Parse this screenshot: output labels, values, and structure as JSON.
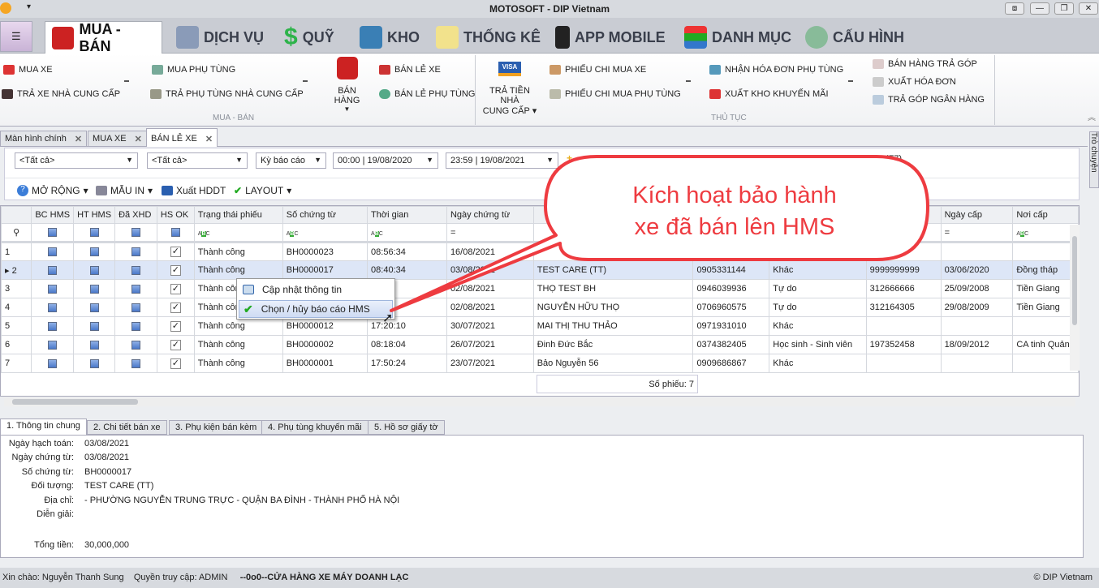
{
  "window": {
    "title": "MOTOSOFT - DIP Vietnam",
    "controls": [
      "⧈",
      "—",
      "❐",
      "✕"
    ]
  },
  "main_tabs": [
    "MUA - BÁN",
    "DỊCH VỤ",
    "QUỸ",
    "KHO",
    "THỐNG KÊ",
    "APP MOBILE",
    "DANH MỤC",
    "CẤU HÌNH"
  ],
  "ribbon": {
    "group1": {
      "label": "MUA - BÁN",
      "mua_xe": "MUA XE",
      "tra_xe": "TRẢ XE NHÀ CUNG CẤP",
      "mua_pt": "MUA PHỤ TÙNG",
      "tra_pt": "TRẢ PHỤ TÙNG NHÀ CUNG CẤP",
      "ban_hang": "BÁN HÀNG",
      "ban_le_xe": "BÁN LẺ XE",
      "ban_le_pt": "BÁN LẺ PHỤ TÙNG"
    },
    "group2": {
      "label": "THỦ TỤC",
      "tra_tien": "TRẢ TIỀN NHÀ",
      "tra_tien2": "CUNG CẤP",
      "pc_mua_xe": "PHIẾU CHI MUA XE",
      "pc_mua_pt": "PHIẾU CHI MUA PHỤ TÙNG",
      "nhan_hd": "NHẬN HÓA ĐƠN PHỤ TÙNG",
      "xuat_km": "XUẤT KHO KHUYẾN MÃI",
      "tra_gop": "BÁN HÀNG TRẢ GÓP",
      "xuat_hd": "XUẤT HÓA ĐƠN",
      "tg_ngan_hang": "TRẢ GÓP NGÂN HÀNG"
    }
  },
  "doc_tabs": [
    "Màn hình chính",
    "MUA XE",
    "BÁN LẺ XE"
  ],
  "side_tab": "Trò chuyện",
  "filters": {
    "f1": "<Tất cả>",
    "f2": "<Tất cả>",
    "period": "Kỳ báo cáo",
    "from": "00:00 | 19/08/2020",
    "to": "23:59 | 19/08/2021",
    "f7": "(F7)"
  },
  "toolbar": {
    "mo_rong": "MỞ RỘNG",
    "mau_in": "MẪU IN",
    "xuat_hddt": "Xuất HDDT",
    "layout": "LAYOUT"
  },
  "grid": {
    "columns": [
      "",
      "BC HMS",
      "HT HMS",
      "Đã XHD",
      "HS OK",
      "Trạng thái phiếu",
      "Số chứng từ",
      "Thời gian",
      "Ngày chứng từ",
      "",
      "",
      "",
      "",
      "Ngày cấp",
      "Nơi cấp"
    ],
    "rows": [
      [
        "1",
        "Thành công",
        "BH0000023",
        "08:56:34",
        "16/08/2021",
        "",
        "",
        "",
        "",
        "",
        ""
      ],
      [
        "2",
        "Thành công",
        "BH0000017",
        "08:40:34",
        "03/08/2021",
        "TEST CARE (TT)",
        "0905331144",
        "Khác",
        "9999999999",
        "03/06/2020",
        "Đồng tháp"
      ],
      [
        "3",
        "Thành công",
        "",
        "08:39",
        "02/08/2021",
        "THỌ TEST BH",
        "0946039936",
        "Tự do",
        "312666666",
        "25/09/2008",
        "Tiền Giang"
      ],
      [
        "4",
        "Thành công",
        "",
        "",
        "02/08/2021",
        "NGUYỄN HỮU THỌ",
        "0706960575",
        "Tự do",
        "312164305",
        "29/08/2009",
        "Tiền Giang"
      ],
      [
        "5",
        "Thành công",
        "BH0000012",
        "17:20:10",
        "30/07/2021",
        "MAI THỊ THU THẢO",
        "0971931010",
        "Khác",
        "",
        "",
        ""
      ],
      [
        "6",
        "Thành công",
        "BH0000002",
        "08:18:04",
        "26/07/2021",
        "Đinh Đức Bắc",
        "0374382405",
        "Học sinh - Sinh viên",
        "197352458",
        "18/09/2012",
        "CA tinh Quảng"
      ],
      [
        "7",
        "Thành công",
        "BH0000001",
        "17:50:24",
        "23/07/2021",
        "Bảo Nguyễn 56",
        "0909686867",
        "Khác",
        "",
        "",
        ""
      ]
    ],
    "selected_row": 2,
    "summary": "Số phiếu: 7"
  },
  "context_menu": [
    "Cập nhật thông tin",
    "Chọn / hủy báo cáo HMS"
  ],
  "callout": {
    "line1": "Kích hoạt bảo hành",
    "line2": "xe đã bán  lên HMS",
    "color": "#ee3b40"
  },
  "bottom_tabs": [
    "1. Thông tin chung",
    "2. Chi tiết bán xe",
    "3. Phụ kiện bán kèm",
    "4. Phụ tùng khuyến mãi",
    "5. Hồ sơ giấy tờ"
  ],
  "detail": [
    {
      "label": "Ngày hạch toán:",
      "value": "03/08/2021"
    },
    {
      "label": "Ngày chứng từ:",
      "value": "03/08/2021"
    },
    {
      "label": "Số chứng từ:",
      "value": "BH0000017"
    },
    {
      "label": "Đối tượng:",
      "value": "TEST CARE (TT)"
    },
    {
      "label": "Địa chỉ:",
      "value": " - PHƯỜNG NGUYỄN TRUNG TRỰC - QUẬN BA ĐÌNH - THÀNH PHỐ HÀ NỘI"
    },
    {
      "label": "Diễn giải:",
      "value": ""
    },
    {
      "label": "Tổng tiền:",
      "value": "30,000,000"
    }
  ],
  "status": {
    "greeting": "Xin chào: Nguyễn Thanh Sung",
    "access": "Quyền truy cập: ADMIN",
    "store": "--0o0--CỬA HÀNG XE MÁY DOANH LẠC",
    "copyright": "© DIP Vietnam"
  }
}
